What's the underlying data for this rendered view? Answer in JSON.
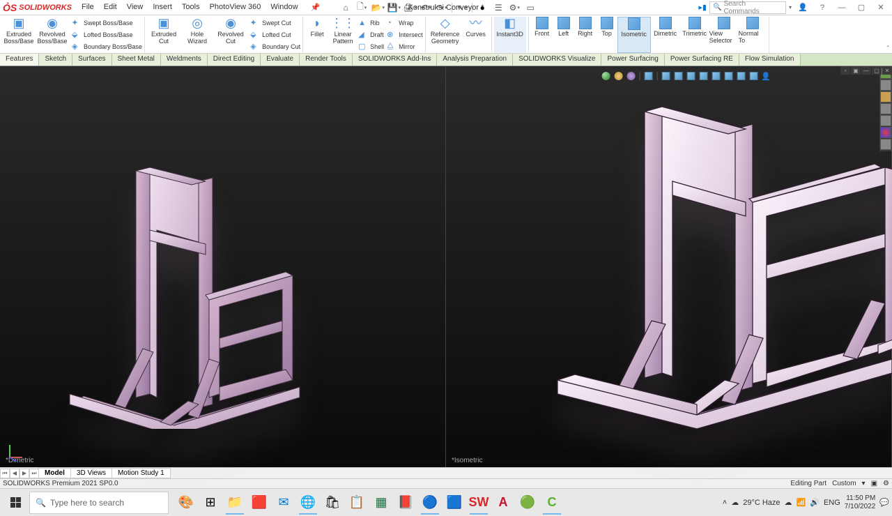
{
  "app": {
    "name": "SOLIDWORKS",
    "document": "Konstruksi Conveyor *"
  },
  "menu": {
    "file": "File",
    "edit": "Edit",
    "view": "View",
    "insert": "Insert",
    "tools": "Tools",
    "photoview": "PhotoView 360",
    "window": "Window"
  },
  "search": {
    "placeholder": "Search Commands"
  },
  "ribbon": {
    "extruded_boss": "Extruded Boss/Base",
    "revolved_boss": "Revolved Boss/Base",
    "swept_boss": "Swept Boss/Base",
    "lofted_boss": "Lofted Boss/Base",
    "boundary_boss": "Boundary Boss/Base",
    "extruded_cut": "Extruded Cut",
    "hole_wizard": "Hole Wizard",
    "revolved_cut": "Revolved Cut",
    "swept_cut": "Swept Cut",
    "lofted_cut": "Lofted Cut",
    "boundary_cut": "Boundary Cut",
    "fillet": "Fillet",
    "linear_pattern": "Linear Pattern",
    "rib": "Rib",
    "draft": "Draft",
    "shell": "Shell",
    "wrap": "Wrap",
    "intersect": "Intersect",
    "mirror": "Mirror",
    "ref_geom": "Reference Geometry",
    "curves": "Curves",
    "instant3d": "Instant3D",
    "front": "Front",
    "left": "Left",
    "right": "Right",
    "top": "Top",
    "isometric": "Isometric",
    "dimetric": "Dimetric",
    "trimetric": "Trimetric",
    "view_selector": "View Selector",
    "normal_to": "Normal To"
  },
  "tabs": {
    "features": "Features",
    "sketch": "Sketch",
    "surfaces": "Surfaces",
    "sheet_metal": "Sheet Metal",
    "weldments": "Weldments",
    "direct_editing": "Direct Editing",
    "evaluate": "Evaluate",
    "render_tools": "Render Tools",
    "sw_addins": "SOLIDWORKS Add-Ins",
    "analysis_prep": "Analysis Preparation",
    "sw_visualize": "SOLIDWORKS Visualize",
    "power_surfacing": "Power Surfacing",
    "power_surfacing_re": "Power Surfacing RE",
    "flow_sim": "Flow Simulation"
  },
  "viewports": {
    "left_label": "*Dimetric",
    "right_label": "*Isometric"
  },
  "bottom_tabs": {
    "model": "Model",
    "views3d": "3D Views",
    "motion": "Motion Study 1"
  },
  "status": {
    "left": "SOLIDWORKS Premium 2021 SP0.0",
    "editing": "Editing Part",
    "units": "Custom"
  },
  "taskbar": {
    "search": "Type here to search",
    "weather": "29°C Haze",
    "time": "11:50 PM",
    "date": "7/10/2022"
  }
}
